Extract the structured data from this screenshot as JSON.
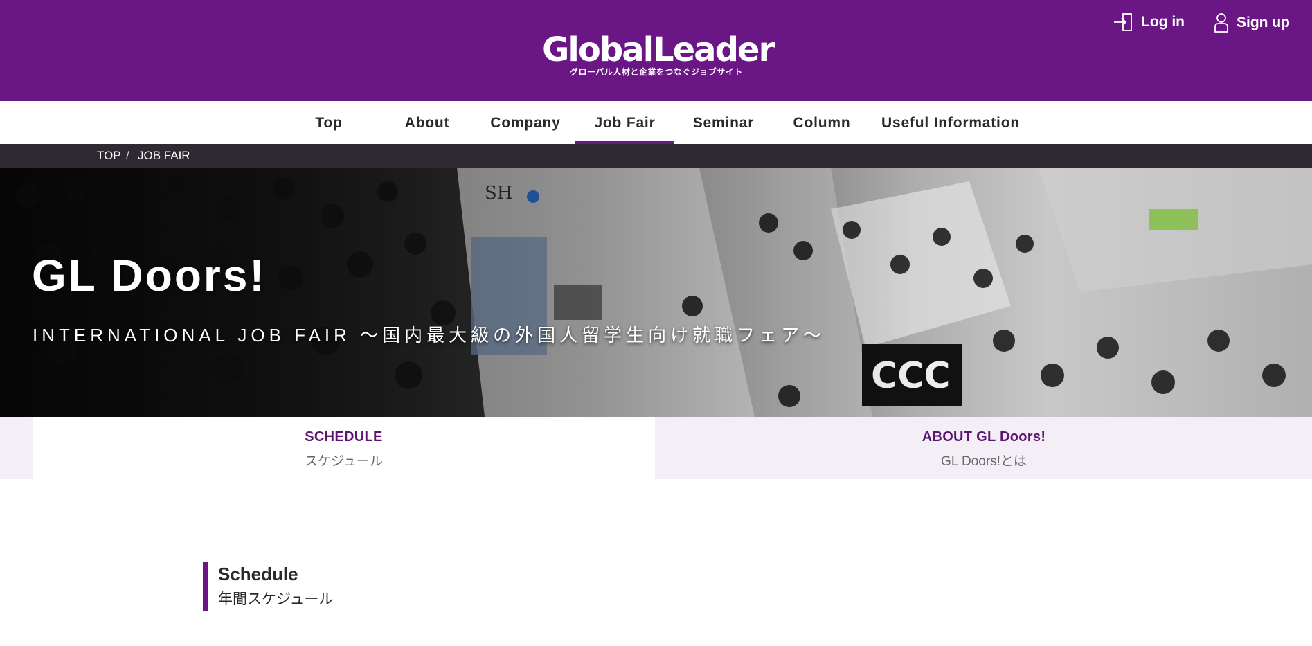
{
  "header": {
    "logo_main": "GlobalLeader",
    "logo_sub": "グローバル人材と企業をつなぐジョブサイト",
    "login_label": "Log in",
    "signup_label": "Sign up"
  },
  "nav": {
    "items": [
      {
        "label": "Top"
      },
      {
        "label": "About"
      },
      {
        "label": "Company"
      },
      {
        "label": "Job Fair",
        "active": true
      },
      {
        "label": "Seminar"
      },
      {
        "label": "Column"
      },
      {
        "label": "Useful Information"
      }
    ]
  },
  "breadcrumb": {
    "items": [
      "TOP",
      "JOB FAIR"
    ],
    "separator": "/"
  },
  "hero": {
    "title": "GL Doors!",
    "subtitle": "INTERNATIONAL JOB FAIR ～国内最大級の外国人留学生向け就職フェア～"
  },
  "tabs": [
    {
      "en": "SCHEDULE",
      "jp": "スケジュール",
      "active": true
    },
    {
      "en": "ABOUT GL Doors!",
      "jp": "GL Doors!とは"
    }
  ],
  "schedule": {
    "heading_en": "Schedule",
    "heading_jp": "年間スケジュール"
  },
  "colors": {
    "brand_purple": "#6a1785",
    "breadcrumb_bg": "#2f2a32",
    "tab_inactive_bg": "#f4eff6"
  },
  "icons": {
    "login": "login-arrow-icon",
    "signup": "user-outline-icon"
  }
}
